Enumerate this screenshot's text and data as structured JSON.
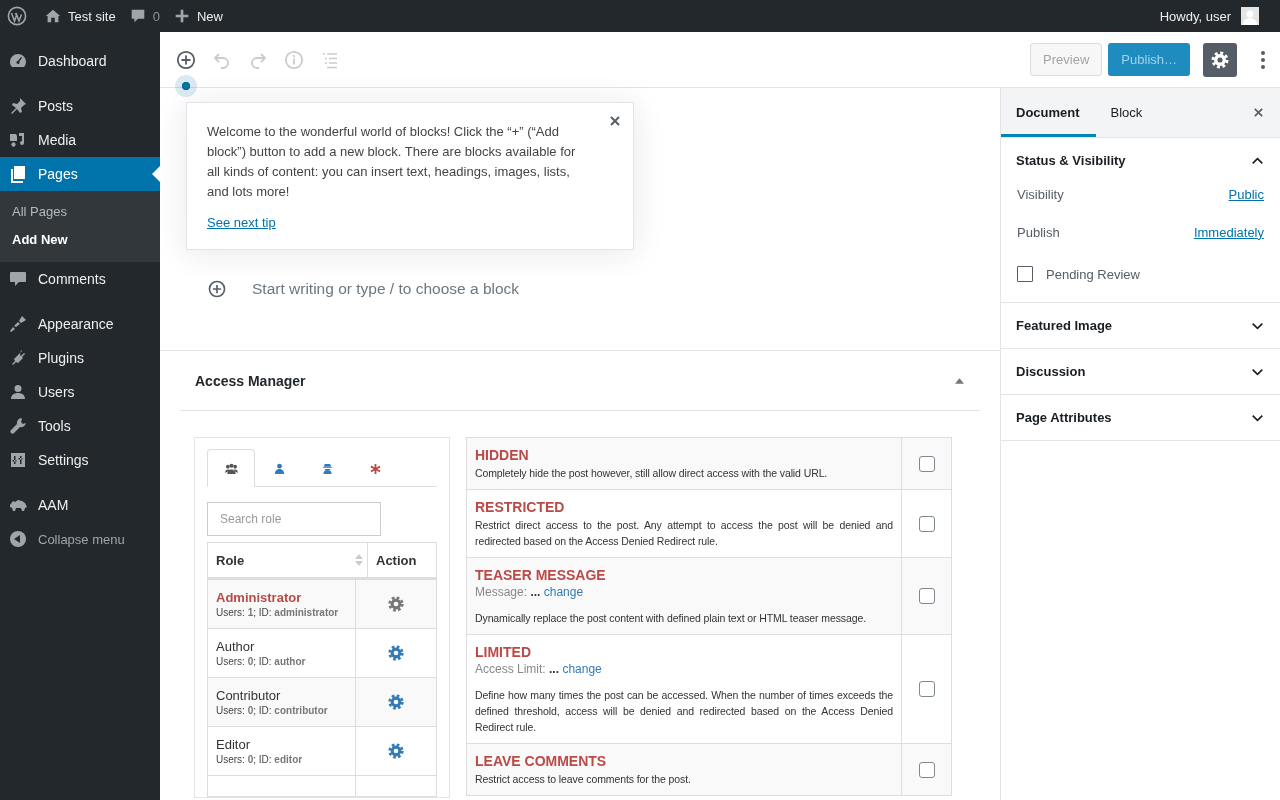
{
  "admin_bar": {
    "site": "Test site",
    "comments_count": "0",
    "new_label": "New",
    "greeting": "Howdy, user"
  },
  "menu": {
    "groups": [
      [
        {
          "label": "Dashboard",
          "selected": false
        }
      ],
      [
        {
          "label": "Posts",
          "selected": false
        },
        {
          "label": "Media",
          "selected": false
        },
        {
          "label": "Pages",
          "selected": true,
          "children": [
            {
              "label": "All Pages",
              "selected": false
            },
            {
              "label": "Add New",
              "selected": true
            }
          ]
        },
        {
          "label": "Comments",
          "selected": false
        }
      ],
      [
        {
          "label": "Appearance",
          "selected": false
        },
        {
          "label": "Plugins",
          "selected": false
        },
        {
          "label": "Users",
          "selected": false
        },
        {
          "label": "Tools",
          "selected": false
        },
        {
          "label": "Settings",
          "selected": false
        }
      ],
      [
        {
          "label": "AAM",
          "selected": false
        }
      ]
    ],
    "collapse": "Collapse menu"
  },
  "toolbar": [
    {
      "disabled": false
    },
    {
      "disabled": true
    },
    {
      "disabled": true
    },
    {
      "disabled": true
    },
    {
      "disabled": true
    }
  ],
  "header_buttons": {
    "preview": "Preview",
    "publish": "Publish…",
    "settings_pressed": true
  },
  "tip": {
    "text": "Welcome to the wonderful world of blocks! Click the “+” (“Add block”) button to add a new block. There are blocks available for all kinds of content: you can insert text, headings, images, lists, and lots more!",
    "link": "See next tip"
  },
  "editor": {
    "placeholder": "Start writing or type / to choose a block"
  },
  "access_manager": {
    "title": "Access Manager",
    "expanded": true,
    "subject_tabs": [
      {
        "selected": true
      },
      {
        "selected": false
      },
      {
        "selected": false
      },
      {
        "selected": false
      }
    ],
    "search": {
      "placeholder": "Search role"
    },
    "columns": [
      "Role",
      "Action"
    ],
    "roles": [
      {
        "name": "Administrator",
        "meta": "Users: **1**; ID: **administrator**",
        "selected": true
      },
      {
        "name": "Author",
        "meta": "Users: **0**; ID: **author**",
        "selected": false
      },
      {
        "name": "Contributor",
        "meta": "Users: **0**; ID: **contributor**",
        "selected": false
      },
      {
        "name": "Editor",
        "meta": "Users: **0**; ID: **editor**",
        "selected": false
      }
    ],
    "options": [
      {
        "title": "HIDDEN",
        "description": "Completely hide the post however, still allow direct access with the valid URL.",
        "checked": false
      },
      {
        "title": "RESTRICTED",
        "description": "Restrict direct access to the post. Any attempt to access the post will be denied and redirected based on the Access Denied Redirect rule.",
        "checked": false
      },
      {
        "title": "TEASER MESSAGE",
        "setting": {
          "label": "Message:",
          "value": "...",
          "link": "change"
        },
        "description": "Dynamically replace the post content with defined plain text or HTML teaser message.",
        "checked": false
      },
      {
        "title": "LIMITED",
        "setting": {
          "label": "Access Limit:",
          "value": "...",
          "link": "change"
        },
        "description": "Define how many times the post can be accessed. When the number of times exceeds the defined threshold, access will be denied and redirected based on the Access Denied Redirect rule.",
        "checked": false
      },
      {
        "title": "LEAVE COMMENTS",
        "description": "Restrict access to leave comments for the post.",
        "checked": false
      }
    ]
  },
  "settings_sidebar": {
    "tabs": [
      {
        "label": "Document",
        "selected": true
      },
      {
        "label": "Block",
        "selected": false
      }
    ],
    "sections": [
      {
        "title": "Status & Visibility",
        "expanded": true,
        "rows": [
          {
            "label": "Visibility",
            "value": "Public"
          },
          {
            "label": "Publish",
            "value": "Immediately"
          }
        ],
        "checkbox": {
          "label": "Pending Review",
          "checked": false
        }
      },
      {
        "title": "Featured Image",
        "expanded": false
      },
      {
        "title": "Discussion",
        "expanded": false
      },
      {
        "title": "Page Attributes",
        "expanded": false
      }
    ]
  }
}
